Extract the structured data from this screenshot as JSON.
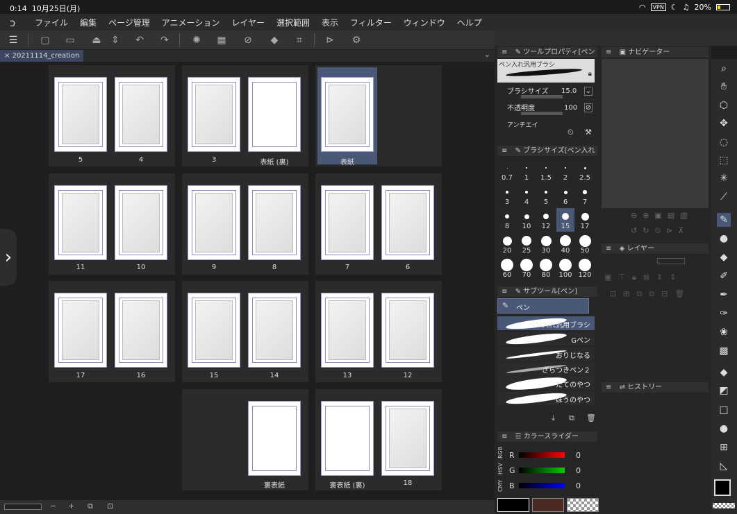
{
  "status": {
    "time": "0:14",
    "date": "10月25日(月)",
    "battery": "20%",
    "vpn": "VPN"
  },
  "menu": {
    "items": [
      "ファイル",
      "編集",
      "ページ管理",
      "アニメーション",
      "レイヤー",
      "選択範囲",
      "表示",
      "フィルター",
      "ウィンドウ",
      "ヘルプ"
    ]
  },
  "tab": {
    "label": "20211114_creation",
    "close": "×"
  },
  "pages": {
    "p5": "5",
    "p4": "4",
    "p3": "3",
    "cover_back": "表紙 (裏)",
    "cover": "表紙",
    "p11": "11",
    "p10": "10",
    "p9": "9",
    "p8": "8",
    "p7": "7",
    "p6": "6",
    "p17": "17",
    "p16": "16",
    "p15": "15",
    "p14": "14",
    "p13": "13",
    "p12": "12",
    "back_cover": "裏表紙",
    "back_cover_back": "裏表紙 (裏)",
    "p18": "18"
  },
  "tool_property": {
    "title": "ツールプロパティ[ペン入",
    "brush_name": "ペン入れ汎用ブラシ",
    "brush_size_label": "ブラシサイズ",
    "brush_size_value": "15.0",
    "opacity_label": "不透明度",
    "opacity_value": "100",
    "aa_label": "アンチエイ"
  },
  "brush_size": {
    "title": "ブラシサイズ[ペン入れ",
    "sizes": [
      "0.7",
      "1",
      "1.5",
      "2",
      "2.5",
      "3",
      "4",
      "5",
      "6",
      "7",
      "8",
      "10",
      "12",
      "15",
      "17",
      "20",
      "25",
      "30",
      "40",
      "50",
      "60",
      "70",
      "80",
      "100",
      "120"
    ],
    "selected": "15"
  },
  "subtool": {
    "title": "サブツール[ペン]",
    "group": "ペン",
    "items": [
      "ペン入れ汎用ブラシ",
      "Gペン",
      "おりじなる",
      "ざらつきペン２",
      "たてのやつ",
      "ほうのやつ"
    ]
  },
  "navigator": {
    "title": "ナビゲーター"
  },
  "layer": {
    "title": "レイヤー"
  },
  "history": {
    "title": "ヒストリー"
  },
  "color_slider": {
    "title": "カラースライダー",
    "modes": [
      "RGB",
      "HSV",
      "CMY"
    ],
    "r_label": "R",
    "g_label": "G",
    "b_label": "B",
    "r": "0",
    "g": "0",
    "b": "0"
  },
  "colors": {
    "accent": "#4a5878",
    "main": "#000000",
    "sub": "#4a2a22"
  }
}
